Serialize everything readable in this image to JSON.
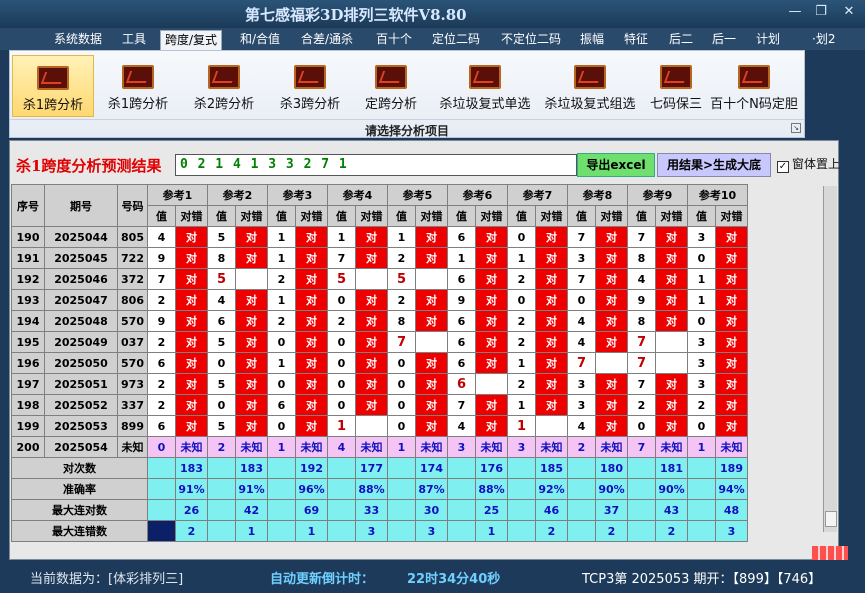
{
  "window": {
    "title": "第七感福彩3D排列三软件V8.80",
    "minimize": "—",
    "restore": "❐",
    "close": "✕"
  },
  "menu": [
    "系统数据",
    "工具",
    "跨度/复式",
    "和/合值",
    "合差/通杀",
    "百十个",
    "定位二码",
    "不定位二码",
    "振幅",
    "特征",
    "后二",
    "后一",
    "计划",
    "·划2"
  ],
  "menu_active": 2,
  "ribbon": {
    "buttons": [
      {
        "label": "杀1跨分析",
        "icon": "chart-icon"
      },
      {
        "label": "杀1跨分析",
        "icon": "chart-icon"
      },
      {
        "label": "杀2跨分析",
        "icon": "chart-icon"
      },
      {
        "label": "杀3跨分析",
        "icon": "chart-icon"
      },
      {
        "label": "定跨分析",
        "icon": "chart-icon"
      },
      {
        "label": "杀垃圾复式单选",
        "icon": "chart-icon"
      },
      {
        "label": "杀垃圾复式组选",
        "icon": "chart-icon"
      },
      {
        "label": "七码保三",
        "icon": "chart-icon"
      },
      {
        "label": "百十个N码定胆",
        "icon": "chart-icon"
      }
    ],
    "selected": 0,
    "caption": "请选择分析项目",
    "launcher": "↘"
  },
  "result": {
    "label": "杀1跨度分析预测结果",
    "value": "0 2 1 4 1 3 3 2 7 1",
    "excel_btn": "导出excel",
    "gen_btn": "用结果>生成大底",
    "checkbox_label": "窗体置上",
    "checkbox_mark": "✓"
  },
  "table": {
    "headers": {
      "seq": "序号",
      "period": "期号",
      "code": "号码",
      "refs": [
        "参考1",
        "参考2",
        "参考3",
        "参考4",
        "参考5",
        "参考6",
        "参考7",
        "参考8",
        "参考9",
        "参考10"
      ],
      "val": "值",
      "match": "对错"
    },
    "rows": [
      {
        "seq": "190",
        "period": "2025044",
        "code": "805",
        "vals": [
          "4",
          "5",
          "1",
          "1",
          "1",
          "6",
          "0",
          "7",
          "7",
          "3"
        ],
        "ok": [
          true,
          true,
          true,
          true,
          true,
          true,
          true,
          true,
          true,
          true
        ]
      },
      {
        "seq": "191",
        "period": "2025045",
        "code": "722",
        "vals": [
          "9",
          "8",
          "1",
          "7",
          "2",
          "1",
          "1",
          "3",
          "8",
          "0"
        ],
        "ok": [
          true,
          true,
          true,
          true,
          true,
          true,
          true,
          true,
          true,
          true
        ]
      },
      {
        "seq": "192",
        "period": "2025046",
        "code": "372",
        "vals": [
          "7",
          "5",
          "2",
          "5",
          "5",
          "6",
          "2",
          "7",
          "4",
          "1"
        ],
        "ok": [
          true,
          false,
          true,
          false,
          false,
          true,
          true,
          true,
          true,
          true
        ]
      },
      {
        "seq": "193",
        "period": "2025047",
        "code": "806",
        "vals": [
          "2",
          "4",
          "1",
          "0",
          "2",
          "9",
          "0",
          "0",
          "9",
          "1"
        ],
        "ok": [
          true,
          true,
          true,
          true,
          true,
          true,
          true,
          true,
          true,
          true
        ]
      },
      {
        "seq": "194",
        "period": "2025048",
        "code": "570",
        "vals": [
          "9",
          "6",
          "2",
          "2",
          "8",
          "6",
          "2",
          "4",
          "8",
          "0"
        ],
        "ok": [
          true,
          true,
          true,
          true,
          true,
          true,
          true,
          true,
          true,
          true
        ]
      },
      {
        "seq": "195",
        "period": "2025049",
        "code": "037",
        "vals": [
          "2",
          "5",
          "0",
          "0",
          "7",
          "6",
          "2",
          "4",
          "7",
          "3"
        ],
        "ok": [
          true,
          true,
          true,
          true,
          false,
          true,
          true,
          true,
          false,
          true
        ]
      },
      {
        "seq": "196",
        "period": "2025050",
        "code": "570",
        "vals": [
          "6",
          "0",
          "1",
          "0",
          "0",
          "6",
          "1",
          "7",
          "7",
          "3"
        ],
        "ok": [
          true,
          true,
          true,
          true,
          true,
          true,
          true,
          false,
          false,
          true
        ]
      },
      {
        "seq": "197",
        "period": "2025051",
        "code": "973",
        "vals": [
          "2",
          "5",
          "0",
          "0",
          "0",
          "6",
          "2",
          "3",
          "7",
          "3"
        ],
        "ok": [
          true,
          true,
          true,
          true,
          true,
          false,
          true,
          true,
          true,
          true
        ]
      },
      {
        "seq": "198",
        "period": "2025052",
        "code": "337",
        "vals": [
          "2",
          "0",
          "6",
          "0",
          "0",
          "7",
          "1",
          "3",
          "2",
          "2"
        ],
        "ok": [
          true,
          true,
          true,
          true,
          true,
          true,
          true,
          true,
          true,
          true
        ]
      },
      {
        "seq": "199",
        "period": "2025053",
        "code": "899",
        "vals": [
          "6",
          "5",
          "0",
          "1",
          "0",
          "4",
          "1",
          "4",
          "0",
          "0"
        ],
        "ok": [
          true,
          true,
          true,
          false,
          true,
          true,
          false,
          true,
          true,
          true
        ]
      }
    ],
    "pending": {
      "seq": "200",
      "period": "2025054",
      "code": "未知",
      "vals": [
        "0",
        "2",
        "1",
        "4",
        "1",
        "3",
        "3",
        "2",
        "7",
        "1"
      ],
      "mark": "未知"
    },
    "stats": [
      {
        "label": "对次数",
        "values": [
          "183",
          "183",
          "192",
          "177",
          "174",
          "176",
          "185",
          "180",
          "181",
          "189"
        ]
      },
      {
        "label": "准确率",
        "values": [
          "91%",
          "91%",
          "96%",
          "88%",
          "87%",
          "88%",
          "92%",
          "90%",
          "90%",
          "94%"
        ]
      },
      {
        "label": "最大连对数",
        "values": [
          "26",
          "42",
          "69",
          "33",
          "30",
          "25",
          "46",
          "37",
          "43",
          "48"
        ]
      },
      {
        "label": "最大连错数",
        "values": [
          "2",
          "1",
          "1",
          "3",
          "3",
          "1",
          "2",
          "2",
          "2",
          "3"
        ]
      }
    ],
    "ok_text": "对"
  },
  "status": {
    "current_label": "当前数据为：[体彩排列三]",
    "countdown_label": "自动更新倒计时：",
    "countdown_value": "22时34分40秒",
    "latest": "TCP3第 2025053 期开：【899】【746】"
  },
  "colors": {
    "hit": "#ee0000",
    "pending": "#f4c4f4",
    "stats": "#7fefef",
    "highlight": "#c00000"
  }
}
